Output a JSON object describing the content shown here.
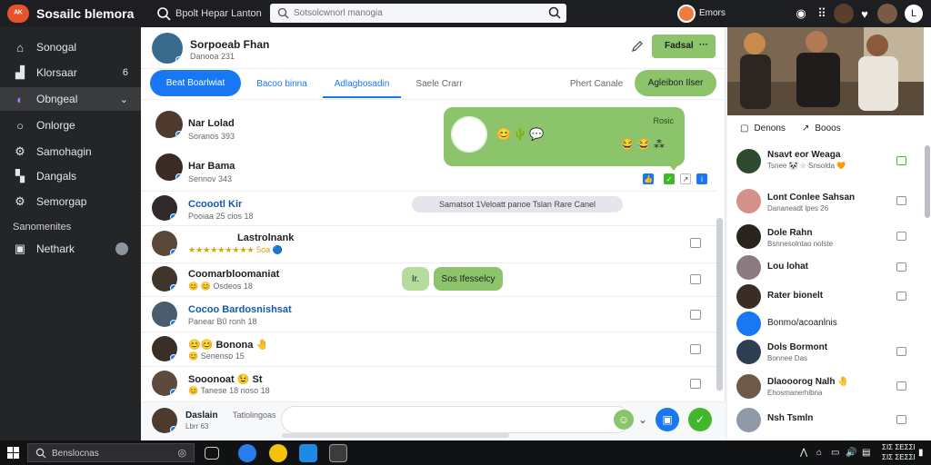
{
  "app": {
    "logo_text": "ᴬᴷ",
    "title": "Sosailc blemora"
  },
  "topbar": {
    "search_label": "Bpolt Hepar Lanton",
    "search_placeholder": "Sotsolcwnorl manogia",
    "user_name": "Emors"
  },
  "sidebar": {
    "items": [
      {
        "label": "Sonogal",
        "icon": "house-icon"
      },
      {
        "label": "Klorsaar",
        "icon": "home-icon",
        "trail": "6"
      },
      {
        "label": "Obngeal",
        "icon": "group-icon",
        "trail": "⌄",
        "active": true
      },
      {
        "label": "Onlorge",
        "icon": "circle-icon"
      },
      {
        "label": "Samohagin",
        "icon": "gear-icon"
      },
      {
        "label": "Dangals",
        "icon": "pages-icon"
      },
      {
        "label": "Semorgap",
        "icon": "settings-icon"
      }
    ],
    "section_title": "Sanomenites",
    "footer_item": {
      "label": "Nethark",
      "icon": "network-icon"
    }
  },
  "profile": {
    "name": "Sorpoeab Fhan",
    "subtitle": "Danooa 231",
    "follow_label": "Fadsal",
    "follow_more": "···"
  },
  "tabs": [
    {
      "label": "Beat Boarlwiat",
      "style": "pill"
    },
    {
      "label": "Bacoo binna",
      "style": "link"
    },
    {
      "label": "Adlagbosadin",
      "style": "underline"
    },
    {
      "label": "Saele Crarr",
      "style": "gray"
    },
    {
      "label": "Phert Canale",
      "style": "gray"
    },
    {
      "label": "Agleibon Ilser",
      "style": "green"
    }
  ],
  "chat": {
    "bubble_meta": "Rosic",
    "bubble_emojis": [
      "😊",
      "🌵",
      "💬"
    ],
    "bubble_reactions": "😂 😂 ⁂",
    "notice": "Samatsot 1Veloatt panoe  Tslan Rare Canel",
    "mini_pills": [
      "Ir.",
      "Sos Ifesselcy"
    ]
  },
  "people": [
    {
      "name": "Nar Lolad",
      "sub": "Soranos 393",
      "blue": false
    },
    {
      "name": "Har Bama",
      "sub": "Sennov 343",
      "blue": false
    },
    {
      "name": "Ccoootl Kir",
      "sub": "Pooiaa 25 cios 18",
      "blue": true
    },
    {
      "name": "Lastrolnank",
      "sub": "★★★★★★★★★ 5oa 🔵",
      "blue": false,
      "stars": true
    },
    {
      "name": "Coomarbloomaniat",
      "sub": "😊 😊 Osdeos 18",
      "blue": false
    },
    {
      "name": "Cocoo Bardosnishsat",
      "sub": "Panear B0 ronh 18",
      "blue": true
    },
    {
      "name": "😊😊 Bonona 🤚",
      "sub": "😊 Senenso 15",
      "blue": false
    },
    {
      "name": "Sooonoat 😉 St",
      "sub": "😊 Tanese 18 noso 18",
      "blue": false
    }
  ],
  "composer": {
    "name": "Daslain",
    "hint": "Tatlolingoas",
    "sub": "Lbrr 63",
    "placeholder": ""
  },
  "right_panel": {
    "actions": [
      {
        "label": "Denons",
        "icon": "chat-icon"
      },
      {
        "label": "Booos",
        "icon": "share-icon"
      }
    ],
    "friends": [
      {
        "name": "Nsavt eor Weaga",
        "sub": "Tsnee 🐼 ☆ Snsolda 🧡"
      },
      {
        "name": "Lont Conlee Sahsan",
        "sub": "Dananeadt lpes 26"
      },
      {
        "name": "Dole Rahn",
        "sub": "Bsnnesolntao nolste"
      },
      {
        "name": "Lou lohat",
        "sub": ""
      },
      {
        "name": "Rater bionelt",
        "sub": ""
      },
      {
        "name": "Bonmo/acoanlnis",
        "sub": ""
      },
      {
        "name": "Dols Bormont",
        "sub": "Bonnee Das"
      },
      {
        "name": "Dlaooorog Nalh 🤚",
        "sub": "Ehosmanerhibna"
      },
      {
        "name": "Nsh Tsmln",
        "sub": ""
      }
    ]
  },
  "taskbar": {
    "search_placeholder": "Benslocnas",
    "clock_time": "ΣΙΣ ΣΕΣΣΙ",
    "clock_date": "ΣΙΣ ΣΕΣΣΙ"
  },
  "colors": {
    "accent": "#1877f2",
    "green": "#8bc46a",
    "sidebar_bg": "#242526",
    "topbar_bg": "#1c1e21"
  }
}
